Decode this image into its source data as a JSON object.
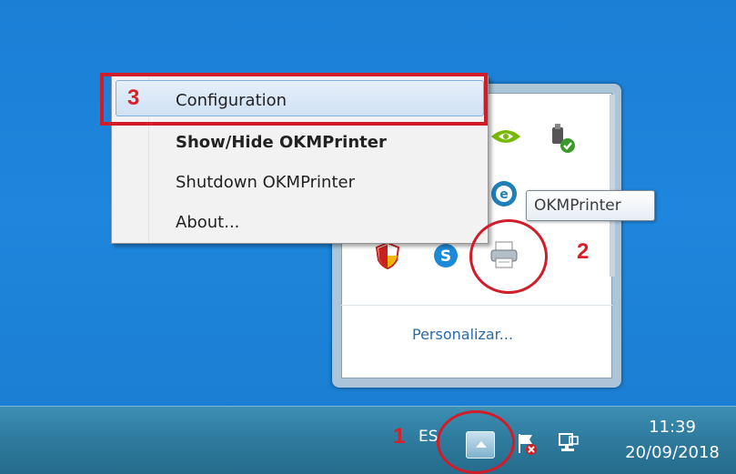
{
  "menu": {
    "items": [
      {
        "label": "Configuration",
        "bold": false,
        "highlighted": true
      },
      {
        "label": "Show/Hide OKMPrinter",
        "bold": true
      },
      {
        "label": "Shutdown OKMPrinter",
        "bold": false
      },
      {
        "label": "About...",
        "bold": false
      }
    ]
  },
  "tooltip": {
    "text": "OKMPrinter"
  },
  "panel": {
    "customize_link": "Personalizar..."
  },
  "taskbar": {
    "language": "ES",
    "time": "11:39",
    "date": "20/09/2018",
    "icons": [
      "show-hidden-icons-button",
      "flag-alert-icon",
      "network-icon"
    ]
  },
  "tray_icons": [
    "nvidia-icon",
    "usb-safe-remove-icon",
    "e-icon",
    "security-shield-icon",
    "skype-icon",
    "printer-icon"
  ],
  "annotations": {
    "step1": "1",
    "step2": "2",
    "step3": "3"
  },
  "colors": {
    "annotation_red": "#d11c2a",
    "desktop_blue": "#1e86dd",
    "highlight": "#cfe1f4"
  }
}
